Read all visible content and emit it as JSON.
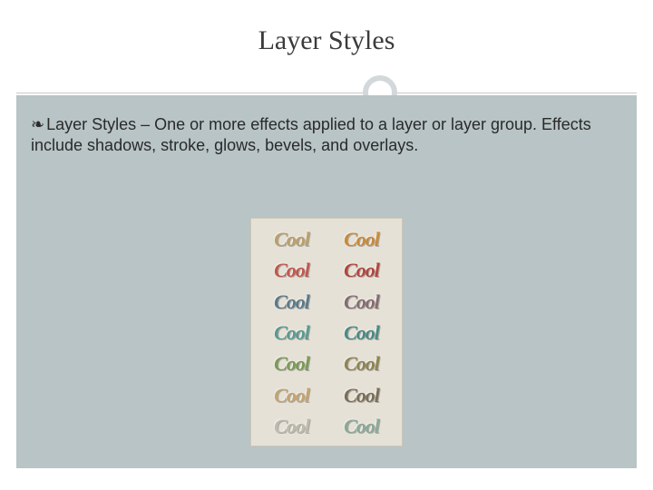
{
  "title": "Layer Styles",
  "bullet_glyph": "❧",
  "body": "Layer Styles – One or more effects applied to a layer or layer group.  Effects include shadows, stroke, glows, bevels, and overlays.",
  "cool_word": "Cool",
  "cool_colors": [
    [
      "#b9a06a",
      "#c88a3a"
    ],
    [
      "#c0584f",
      "#b0463f"
    ],
    [
      "#5a7a8c",
      "#846c72"
    ],
    [
      "#5a9a92",
      "#4a8a86"
    ],
    [
      "#7a9a56",
      "#8e8452"
    ],
    [
      "#c4a472",
      "#7a6e58"
    ],
    [
      "#bdbab0",
      "#8aa89a"
    ]
  ]
}
